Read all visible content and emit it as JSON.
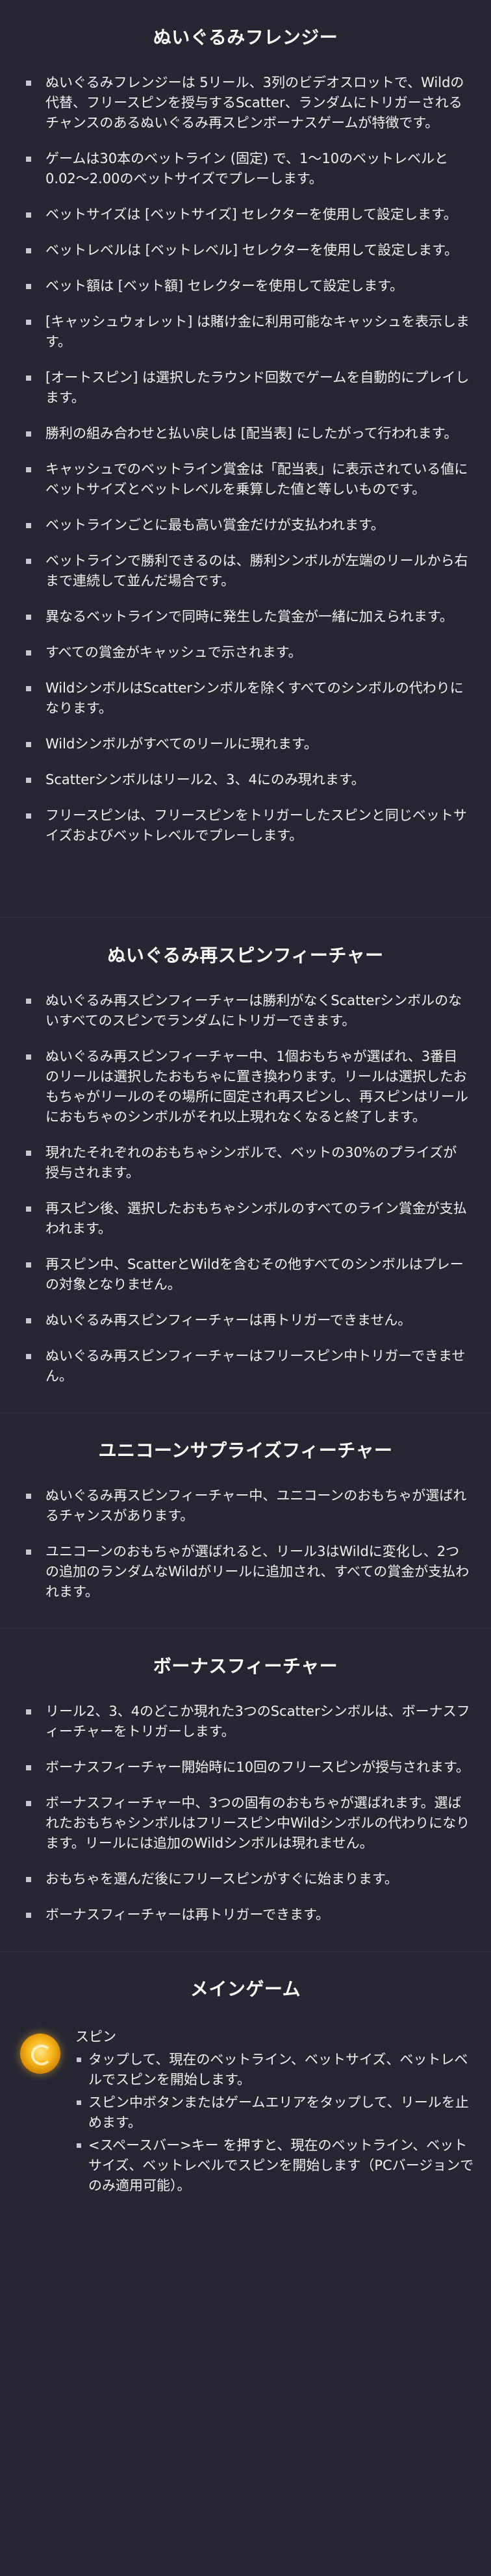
{
  "sections": [
    {
      "title": "ぬいぐるみフレンジー",
      "items": [
        "ぬいぐるみフレンジーは 5リール、3列のビデオスロットで、Wildの代替、フリースピンを授与するScatter、ランダムにトリガーされるチャンスのあるぬいぐるみ再スピンボーナスゲームが特徴です。",
        "ゲームは30本のベットライン (固定) で、1～10のベットレベルと0.02～2.00のベットサイズでプレーします。",
        "ベットサイズは [ベットサイズ] セレクターを使用して設定します。",
        "ベットレベルは [ベットレベル] セレクターを使用して設定します。",
        "ベット額は [ベット額] セレクターを使用して設定します。",
        "[キャッシュウォレット] は賭け金に利用可能なキャッシュを表示します。",
        "[オートスピン] は選択したラウンド回数でゲームを自動的にプレイします。",
        "勝利の組み合わせと払い戻しは [配当表] にしたがって行われます。",
        "キャッシュでのベットライン賞金は「配当表」に表示されている値にベットサイズとベットレベルを乗算した値と等しいものです。",
        "ベットラインごとに最も高い賞金だけが支払われます。",
        "ベットラインで勝利できるのは、勝利シンボルが左端のリールから右まで連続して並んだ場合です。",
        "異なるベットラインで同時に発生した賞金が一緒に加えられます。",
        "すべての賞金がキャッシュで示されます。",
        "WildシンボルはScatterシンボルを除くすべてのシンボルの代わりになります。",
        "Wildシンボルがすべてのリールに現れます。",
        "Scatterシンボルはリール2、3、4にのみ現れます。",
        "フリースピンは、フリースピンをトリガーしたスピンと同じベットサイズおよびベットレベルでプレーします。"
      ]
    },
    {
      "title": "ぬいぐるみ再スピンフィーチャー",
      "items": [
        "ぬいぐるみ再スピンフィーチャーは勝利がなくScatterシンボルのないすべてのスピンでランダムにトリガーできます。",
        "ぬいぐるみ再スピンフィーチャー中、1個おもちゃが選ばれ、3番目のリールは選択したおもちゃに置き換わります。リールは選択したおもちゃがリールのその場所に固定され再スピンし、再スピンはリールにおもちゃのシンボルがそれ以上現れなくなると終了します。",
        "現れたそれぞれのおもちゃシンボルで、ベットの30%のプライズが授与されます。",
        "再スピン後、選択したおもちゃシンボルのすべてのライン賞金が支払われます。",
        "再スピン中、ScatterとWildを含むその他すべてのシンボルはプレーの対象となりません。",
        "ぬいぐるみ再スピンフィーチャーは再トリガーできません。",
        "ぬいぐるみ再スピンフィーチャーはフリースピン中トリガーできません。"
      ]
    },
    {
      "title": "ユニコーンサプライズフィーチャー",
      "items": [
        "ぬいぐるみ再スピンフィーチャー中、ユニコーンのおもちゃが選ばれるチャンスがあります。",
        "ユニコーンのおもちゃが選ばれると、リール3はWildに変化し、2つの追加のランダムなWildがリールに追加され、すべての賞金が支払われます。"
      ]
    },
    {
      "title": "ボーナスフィーチャー",
      "items": [
        "リール2、3、4のどこか現れた3つのScatterシンボルは、ボーナスフィーチャーをトリガーします。",
        "ボーナスフィーチャー開始時に10回のフリースピンが授与されます。",
        "ボーナスフィーチャー中、3つの固有のおもちゃが選ばれます。選ばれたおもちゃシンボルはフリースピン中Wildシンボルの代わりになります。リールには追加のWildシンボルは現れません。",
        "おもちゃを選んだ後にフリースピンがすぐに始まります。",
        "ボーナスフィーチャーは再トリガーできます。"
      ]
    }
  ],
  "main_game": {
    "title": "メインゲーム",
    "spin_icon": "spin-button-icon",
    "spin_label": "スピン",
    "spin_items": [
      "タップして、現在のベットライン、ベットサイズ、ベットレベルでスピンを開始します。",
      "スピン中ボタンまたはゲームエリアをタップして、リールを止めます。",
      "<スペースバー>キー を押すと、現在のベットライン、ベットサイズ、ベットレベルでスピンを開始します（PCバージョンでのみ適用可能）。"
    ]
  }
}
